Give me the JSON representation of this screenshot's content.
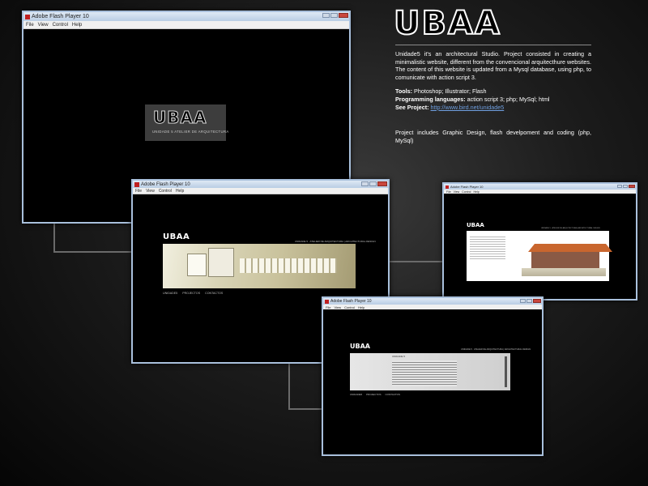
{
  "brand": {
    "logo_text": "UBAA"
  },
  "window": {
    "title": "Adobe Flash Player 10",
    "menu": [
      "File",
      "View",
      "Control",
      "Help"
    ]
  },
  "splash": {
    "subtitle": "UNIDADE 5  ATELIER DE ARQUITECTURA"
  },
  "site": {
    "tagline": "UNIDADE 5 · ATELIER DE ARQUITECTURA | ARCHITECTURAL DESIGN",
    "nav": [
      "UNIDADE5",
      "PROJECTOS",
      "CONTACTOS"
    ],
    "panel_title": "UNIDADE 5"
  },
  "description": {
    "intro": "Unidade5 it's  an architectural Studio. Project consisted in creating a minimalistic website, different from the convencional arquitecthure websites. The content of this website is updated from a Mysql database, using php, to comunicate with action script 3.",
    "tools_label": "Tools:",
    "tools_value": " Photoshop; Illustrator; Flash",
    "lang_label": "Programming languages:",
    "lang_value": "  action script 3; php; MySql; html",
    "see_label": "See Project:",
    "see_link": "http://www.bird.net/unidade5",
    "includes": "Project includes Graphic Design, flash develpoment and coding (php, MySql)"
  },
  "colors": {
    "accent_link": "#6f9fe0",
    "frame": "#a9c0dc",
    "close": "#c9463d"
  }
}
